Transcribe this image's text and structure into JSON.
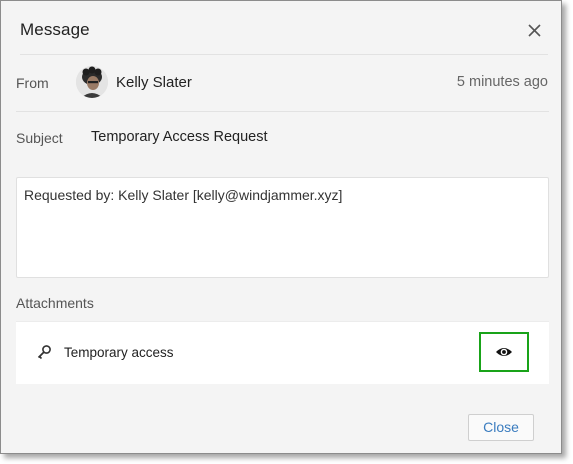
{
  "dialog": {
    "title": "Message",
    "close_icon": "close-icon"
  },
  "from": {
    "label": "From",
    "name": "Kelly Slater",
    "time": "5 minutes ago",
    "avatar_icon": "avatar"
  },
  "subject": {
    "label": "Subject",
    "value": "Temporary Access Request"
  },
  "body": {
    "text": "Requested by: Kelly Slater [kelly@windjammer.xyz]"
  },
  "attachments": {
    "label": "Attachments",
    "items": [
      {
        "name": "Temporary access",
        "icon": "key-icon",
        "action_icon": "eye-icon"
      }
    ]
  },
  "footer": {
    "close_label": "Close"
  },
  "colors": {
    "highlight": "#19a319",
    "link": "#3a7cbf"
  }
}
